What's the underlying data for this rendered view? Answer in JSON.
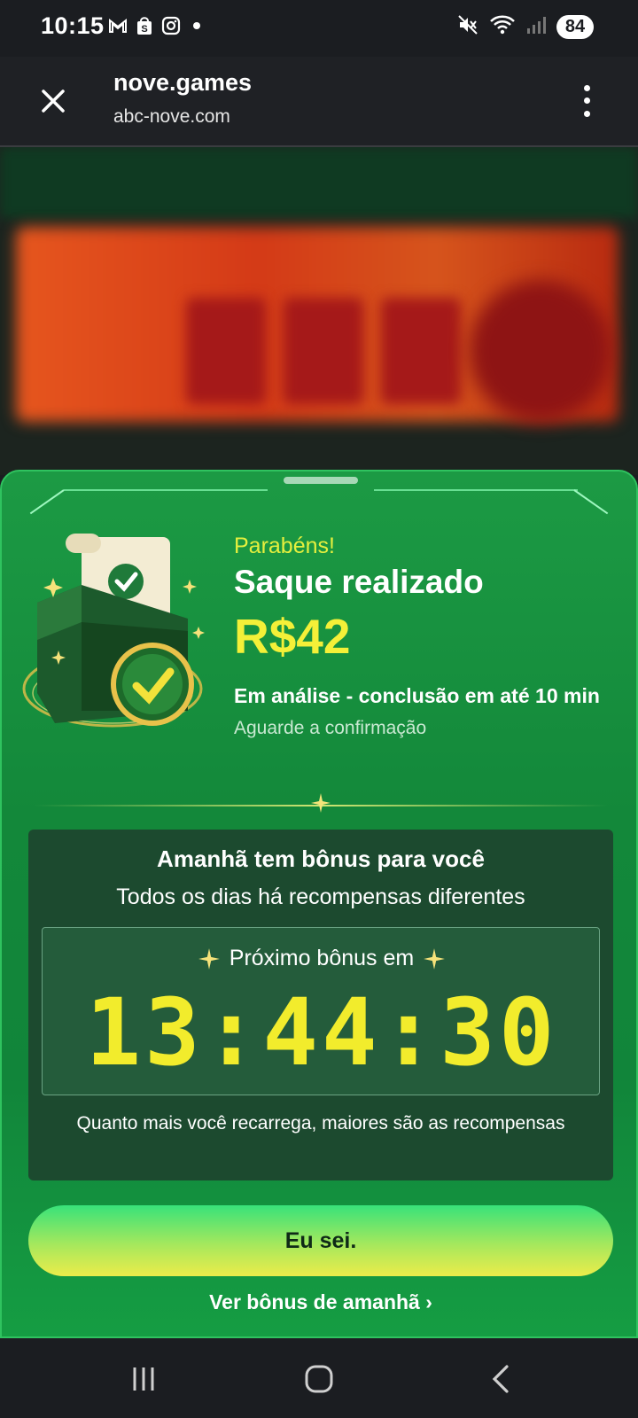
{
  "status_bar": {
    "time": "10:15",
    "battery": "84",
    "left_icons": [
      "gmail-icon",
      "shopping-bag-icon",
      "instagram-icon",
      "notification-dot"
    ],
    "right_icons": [
      "mute-icon",
      "wifi-icon",
      "signal-icon"
    ]
  },
  "browser": {
    "title": "nove.games",
    "url": "abc-nove.com"
  },
  "sheet": {
    "congrats": "Parabéns!",
    "title": "Saque realizado",
    "amount": "R$42",
    "status": "Em análise - conclusão em até 10 min",
    "confirm": "Aguarde a confirmação"
  },
  "bonus": {
    "title": "Amanhã tem bônus para você",
    "subtitle": "Todos os dias há recompensas diferentes",
    "timer_label": "Próximo bônus em",
    "timer": "13:44:30",
    "note": "Quanto mais você recarrega, maiores são as recompensas"
  },
  "actions": {
    "primary": "Eu sei.",
    "link": "Ver bônus de amanhã"
  },
  "colors": {
    "accent_yellow": "#f4f038",
    "sheet_green": "#13883a",
    "panel_green": "#1c4a2f"
  }
}
